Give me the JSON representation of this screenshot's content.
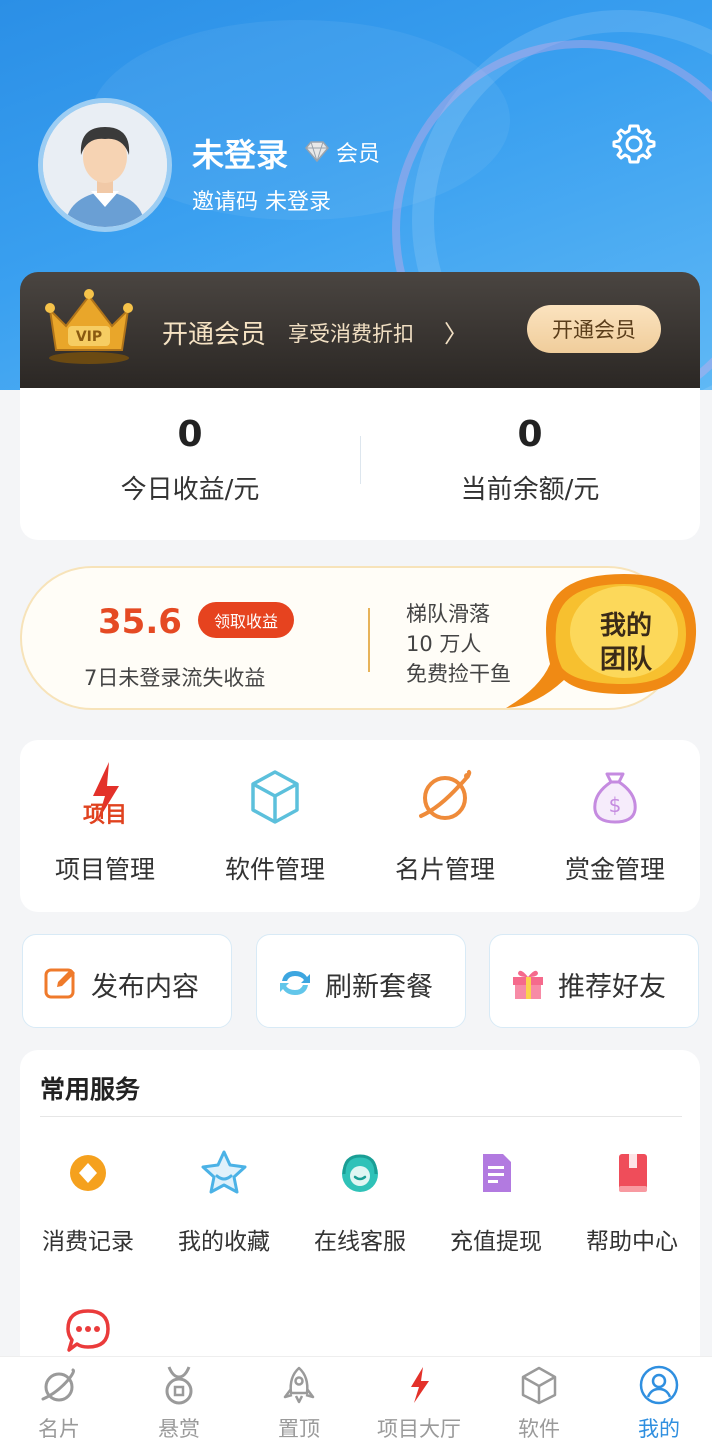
{
  "profile": {
    "username": "未登录",
    "member_label": "会员",
    "invite_label": "邀请码",
    "invite_value": "未登录"
  },
  "vip": {
    "title": "开通会员",
    "subtitle": "享受消费折扣",
    "arrow": "〉",
    "button": "开通会员",
    "crown_text": "VIP"
  },
  "stats": [
    {
      "value": "0",
      "label": "今日收益/元"
    },
    {
      "value": "0",
      "label": "当前余额/元"
    }
  ],
  "earnings": {
    "amount": "35.6",
    "claim_button": "领取收益",
    "lost_label": "7日未登录流失收益",
    "team_lines": [
      "梯队滑落",
      "10 万人",
      "免费捡干鱼"
    ],
    "team_badge": [
      "我的",
      "团队"
    ]
  },
  "management": [
    {
      "label": "项目管理",
      "icon": "project-icon"
    },
    {
      "label": "软件管理",
      "icon": "cube-icon"
    },
    {
      "label": "名片管理",
      "icon": "planet-icon"
    },
    {
      "label": "赏金管理",
      "icon": "money-bag-icon"
    }
  ],
  "project_icon_text": "项目",
  "quick_actions": [
    {
      "label": "发布内容",
      "icon": "edit-icon"
    },
    {
      "label": "刷新套餐",
      "icon": "refresh-icon"
    },
    {
      "label": "推荐好友",
      "icon": "gift-icon"
    }
  ],
  "services": {
    "title": "常用服务",
    "items": [
      {
        "label": "消费记录",
        "icon": "coin-icon"
      },
      {
        "label": "我的收藏",
        "icon": "star-icon"
      },
      {
        "label": "在线客服",
        "icon": "headset-icon"
      },
      {
        "label": "充值提现",
        "icon": "document-icon"
      },
      {
        "label": "帮助中心",
        "icon": "book-icon"
      },
      {
        "label": "",
        "icon": "chat-icon"
      }
    ]
  },
  "tabs": [
    {
      "label": "名片",
      "icon": "planet-icon",
      "active": false
    },
    {
      "label": "悬赏",
      "icon": "medal-icon",
      "active": false
    },
    {
      "label": "置顶",
      "icon": "rocket-icon",
      "active": false
    },
    {
      "label": "项目大厅",
      "icon": "lightning-icon",
      "active": false
    },
    {
      "label": "软件",
      "icon": "cube-icon",
      "active": false
    },
    {
      "label": "我的",
      "icon": "user-icon",
      "active": true
    }
  ],
  "colors": {
    "hero_blue": "#2b8fe6",
    "accent_red": "#e54a23",
    "tab_active": "#2f8fe0",
    "vip_gold": "#f0cd9b"
  }
}
